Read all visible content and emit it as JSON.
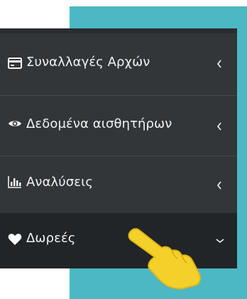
{
  "menu": {
    "items": [
      {
        "label": "Συναλλαγές Αρχών",
        "icon": "credit-card-icon",
        "state": "collapsed"
      },
      {
        "label": "Δεδομένα αισθητήρων",
        "icon": "eye-icon",
        "state": "collapsed"
      },
      {
        "label": "Αναλύσεις",
        "icon": "bar-chart-icon",
        "state": "collapsed"
      },
      {
        "label": "Δωρεές",
        "icon": "heart-icon",
        "state": "expanded",
        "active": true
      }
    ]
  },
  "overlay": {
    "pointer": "pointing-hand-icon",
    "pointer_color": "#f4d12a"
  },
  "colors": {
    "sidebar_bg": "#323639",
    "active_bg": "#222528",
    "accent_bg": "#4cb8c4",
    "text": "#f2f2f2"
  }
}
